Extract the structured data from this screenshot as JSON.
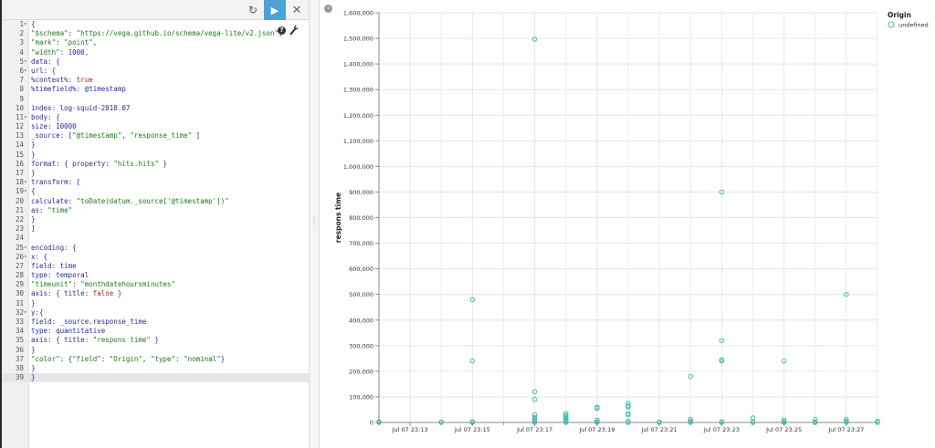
{
  "toolbar": {
    "refresh_icon": "refresh-icon",
    "run_icon": "play-icon",
    "close_icon": "close-icon",
    "refresh_glyph": "↻",
    "run_glyph": "▶",
    "close_glyph": "✕"
  },
  "editor": {
    "help_glyph": "?",
    "active_line": 39,
    "lines": [
      {
        "n": "1",
        "fold": "▾",
        "text": "{"
      },
      {
        "n": "2",
        "fold": "",
        "text": "\"$schema\": \"https://vega.github.io/schema/vega-lite/v2.json\","
      },
      {
        "n": "3",
        "fold": "",
        "text": "\"mark\": \"point\","
      },
      {
        "n": "4",
        "fold": "",
        "text": "\"width\": 1000,"
      },
      {
        "n": "5",
        "fold": "▾",
        "text": "data: {"
      },
      {
        "n": "6",
        "fold": "▾",
        "text": "url: {"
      },
      {
        "n": "7",
        "fold": "",
        "text": "%context%: true"
      },
      {
        "n": "8",
        "fold": "",
        "text": "%timefield%: @timestamp"
      },
      {
        "n": "9",
        "fold": "",
        "text": ""
      },
      {
        "n": "10",
        "fold": "",
        "text": "index: log-squid-2018.07"
      },
      {
        "n": "11",
        "fold": "▾",
        "text": "body: {"
      },
      {
        "n": "12",
        "fold": "",
        "text": "size: 10000"
      },
      {
        "n": "13",
        "fold": "",
        "text": "_source: [\"@timestamp\", \"response_time\" ]"
      },
      {
        "n": "14",
        "fold": "",
        "text": "}"
      },
      {
        "n": "15",
        "fold": "",
        "text": "}"
      },
      {
        "n": "16",
        "fold": "",
        "text": "format: { property: \"hits.hits\" }"
      },
      {
        "n": "17",
        "fold": "",
        "text": "}"
      },
      {
        "n": "18",
        "fold": "▾",
        "text": "transform: ["
      },
      {
        "n": "19",
        "fold": "▾",
        "text": "{"
      },
      {
        "n": "20",
        "fold": "",
        "text": "calculate: \"toDate(datum._source['@timestamp'])\""
      },
      {
        "n": "21",
        "fold": "",
        "text": "as: \"time\""
      },
      {
        "n": "22",
        "fold": "",
        "text": "}"
      },
      {
        "n": "23",
        "fold": "",
        "text": "]"
      },
      {
        "n": "24",
        "fold": "",
        "text": ""
      },
      {
        "n": "25",
        "fold": "▾",
        "text": "encoding: {"
      },
      {
        "n": "26",
        "fold": "▾",
        "text": "x: {"
      },
      {
        "n": "27",
        "fold": "",
        "text": "field: time"
      },
      {
        "n": "28",
        "fold": "",
        "text": "type: temporal"
      },
      {
        "n": "29",
        "fold": "",
        "text": "\"timeunit\": \"monthdatehoursminutes\""
      },
      {
        "n": "30",
        "fold": "",
        "text": "axis: { title: false }"
      },
      {
        "n": "31",
        "fold": "",
        "text": "}"
      },
      {
        "n": "32",
        "fold": "▾",
        "text": "y:{"
      },
      {
        "n": "33",
        "fold": "",
        "text": "field: _source.response_time"
      },
      {
        "n": "34",
        "fold": "",
        "text": "type: quantitative"
      },
      {
        "n": "35",
        "fold": "",
        "text": "axis: { title: \"respons time\" }"
      },
      {
        "n": "36",
        "fold": "",
        "text": "}"
      },
      {
        "n": "37",
        "fold": "",
        "text": "\"color\": {\"field\": \"Origin\", \"type\": \"nominal\"}"
      },
      {
        "n": "38",
        "fold": "",
        "text": "}"
      },
      {
        "n": "39",
        "fold": "",
        "text": "}"
      }
    ]
  },
  "chart_pane": {
    "collapse_glyph": "‹"
  },
  "chart_data": {
    "type": "scatter",
    "ylabel": "respons time",
    "ylim": [
      0,
      1600000
    ],
    "yticks": [
      0,
      100000,
      200000,
      300000,
      400000,
      500000,
      600000,
      700000,
      800000,
      900000,
      1000000,
      1100000,
      1200000,
      1300000,
      1400000,
      1500000,
      1600000
    ],
    "ytick_labels": [
      "0",
      "100,000",
      "200,000",
      "300,000",
      "400,000",
      "500,000",
      "600,000",
      "700,000",
      "800,000",
      "900,000",
      "1,000,000",
      "1,100,000",
      "1,200,000",
      "1,300,000",
      "1,400,000",
      "1,500,000",
      "1,600,000"
    ],
    "xlim_minutes": [
      23.0,
      28.0
    ],
    "xticks_minutes": [
      13,
      15,
      17,
      19,
      21,
      23,
      25,
      27
    ],
    "xtick_labels": [
      "Jul 07 23:13",
      "Jul 07 23:15",
      "Jul 07 23:17",
      "Jul 07 23:19",
      "Jul 07 23:21",
      "Jul 07 23:23",
      "Jul 07 23:25",
      "Jul 07 23:27"
    ],
    "x_min": 12.0,
    "x_max": 28.0,
    "grid": true,
    "legend_title": "Origin",
    "legend_placement": "top-right",
    "series": [
      {
        "name": "undefined",
        "color": "#3cb8ae",
        "points": [
          [
            12.0,
            0
          ],
          [
            12.0,
            3000
          ],
          [
            14.0,
            0
          ],
          [
            14.0,
            2000
          ],
          [
            15.0,
            480000
          ],
          [
            15.0,
            240000
          ],
          [
            15.0,
            0
          ],
          [
            15.0,
            3000
          ],
          [
            17.0,
            1497000
          ],
          [
            17.0,
            120000
          ],
          [
            17.0,
            90000
          ],
          [
            17.0,
            30000
          ],
          [
            17.0,
            20000
          ],
          [
            17.0,
            15000
          ],
          [
            17.0,
            10000
          ],
          [
            17.0,
            5000
          ],
          [
            17.0,
            0
          ],
          [
            18.0,
            35000
          ],
          [
            18.0,
            28000
          ],
          [
            18.0,
            22000
          ],
          [
            18.0,
            16000
          ],
          [
            18.0,
            10000
          ],
          [
            18.0,
            5000
          ],
          [
            18.0,
            0
          ],
          [
            19.0,
            60000
          ],
          [
            19.0,
            55000
          ],
          [
            19.0,
            10000
          ],
          [
            19.0,
            3000
          ],
          [
            19.0,
            0
          ],
          [
            20.0,
            75000
          ],
          [
            20.0,
            65000
          ],
          [
            20.0,
            60000
          ],
          [
            20.0,
            35000
          ],
          [
            20.0,
            30000
          ],
          [
            20.0,
            5000
          ],
          [
            20.0,
            0
          ],
          [
            21.0,
            2000
          ],
          [
            21.0,
            0
          ],
          [
            22.0,
            180000
          ],
          [
            22.0,
            12000
          ],
          [
            22.0,
            5000
          ],
          [
            22.0,
            0
          ],
          [
            23.0,
            900000
          ],
          [
            23.0,
            320000
          ],
          [
            23.0,
            245000
          ],
          [
            23.0,
            240000
          ],
          [
            23.0,
            3000
          ],
          [
            23.0,
            0
          ],
          [
            24.0,
            18000
          ],
          [
            24.0,
            2000
          ],
          [
            24.0,
            0
          ],
          [
            25.0,
            240000
          ],
          [
            25.0,
            10000
          ],
          [
            25.0,
            3000
          ],
          [
            25.0,
            0
          ],
          [
            26.0,
            12000
          ],
          [
            26.0,
            2000
          ],
          [
            26.0,
            0
          ],
          [
            27.0,
            500000
          ],
          [
            27.0,
            12000
          ],
          [
            27.0,
            5000
          ],
          [
            27.0,
            0
          ],
          [
            28.0,
            5000
          ],
          [
            28.0,
            0
          ]
        ]
      }
    ]
  }
}
